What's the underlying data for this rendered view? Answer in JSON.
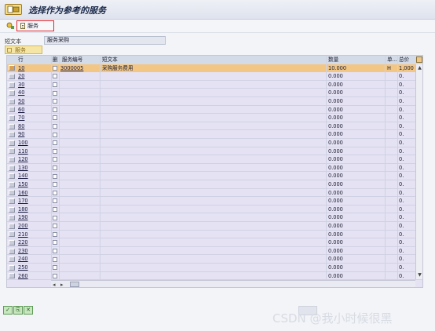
{
  "window": {
    "title": "选择作为参考的服务"
  },
  "toolbar": {
    "service_button_label": "服务"
  },
  "short_text": {
    "label": "短文本",
    "value": "服务采购"
  },
  "tab": {
    "label": "服务"
  },
  "table": {
    "headers": {
      "line": "行",
      "delete": "删",
      "service_no": "服务编号",
      "short_text": "短文本",
      "quantity": "数量",
      "unit": "单...",
      "total": "总价"
    },
    "selected_row": {
      "line": "10",
      "service_no": "3000005",
      "short_text": "采购服务费用",
      "quantity": "10.000",
      "unit": "H",
      "total": "1,000"
    },
    "empty_lines": [
      "20",
      "30",
      "40",
      "50",
      "60",
      "70",
      "80",
      "90",
      "100",
      "110",
      "120",
      "130",
      "140",
      "150",
      "160",
      "170",
      "180",
      "190",
      "200",
      "210",
      "220",
      "230",
      "240",
      "250",
      "260"
    ],
    "empty_quantity": "0.000",
    "empty_total": "0."
  },
  "watermark": "CSDN @我小时候很黑",
  "icons": [
    "app-icon",
    "service-doc-icon",
    "toolbar-icon",
    "settings-icon",
    "scroll-up-icon",
    "scroll-down-icon",
    "scroll-left-icon",
    "scroll-right-icon"
  ]
}
